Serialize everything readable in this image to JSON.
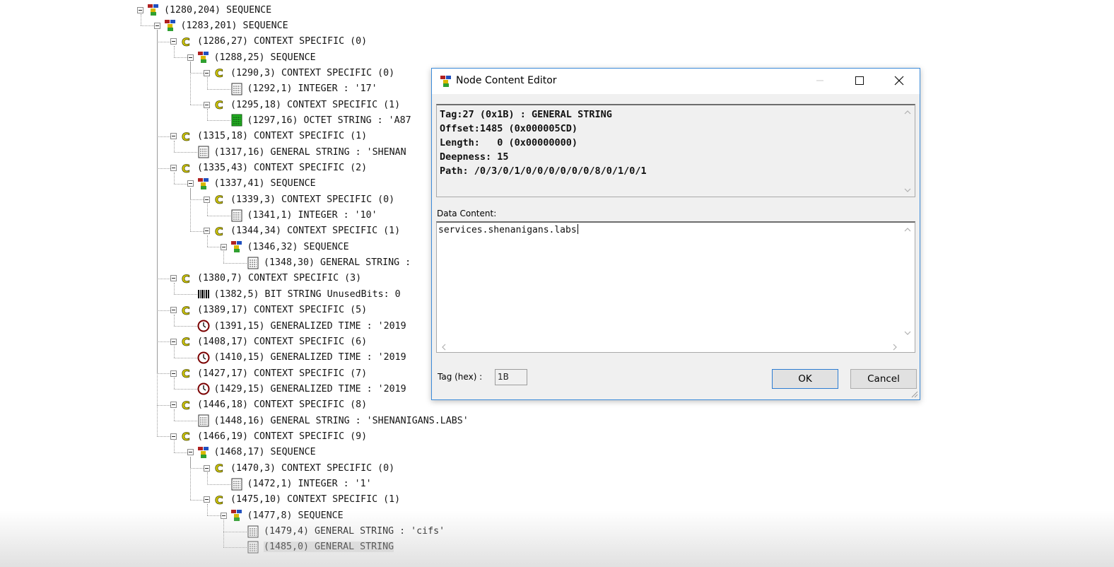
{
  "tree": {
    "nodes": [
      {
        "depth": 0,
        "icon": "sequence-icon",
        "text": "(1280,204) SEQUENCE",
        "expander": true
      },
      {
        "depth": 1,
        "icon": "sequence-icon",
        "text": "(1283,201) SEQUENCE",
        "expander": true
      },
      {
        "depth": 2,
        "icon": "context-specific-icon",
        "text": "(1286,27) CONTEXT SPECIFIC (0)",
        "expander": true
      },
      {
        "depth": 3,
        "icon": "sequence-icon",
        "text": "(1288,25) SEQUENCE",
        "expander": true
      },
      {
        "depth": 4,
        "icon": "context-specific-icon",
        "text": "(1290,3) CONTEXT SPECIFIC (0)",
        "expander": true
      },
      {
        "depth": 5,
        "icon": "integer-icon",
        "text": "(1292,1) INTEGER : '17'",
        "expander": false
      },
      {
        "depth": 4,
        "icon": "context-specific-icon",
        "text": "(1295,18) CONTEXT SPECIFIC (1)",
        "expander": true
      },
      {
        "depth": 5,
        "icon": "octet-string-icon",
        "text": "(1297,16) OCTET STRING : 'A87",
        "expander": false
      },
      {
        "depth": 2,
        "icon": "context-specific-icon",
        "text": "(1315,18) CONTEXT SPECIFIC (1)",
        "expander": true
      },
      {
        "depth": 3,
        "icon": "general-string-icon",
        "text": "(1317,16) GENERAL STRING : 'SHENAN",
        "expander": false
      },
      {
        "depth": 2,
        "icon": "context-specific-icon",
        "text": "(1335,43) CONTEXT SPECIFIC (2)",
        "expander": true
      },
      {
        "depth": 3,
        "icon": "sequence-icon",
        "text": "(1337,41) SEQUENCE",
        "expander": true
      },
      {
        "depth": 4,
        "icon": "context-specific-icon",
        "text": "(1339,3) CONTEXT SPECIFIC (0)",
        "expander": true
      },
      {
        "depth": 5,
        "icon": "integer-icon",
        "text": "(1341,1) INTEGER : '10'",
        "expander": false
      },
      {
        "depth": 4,
        "icon": "context-specific-icon",
        "text": "(1344,34) CONTEXT SPECIFIC (1)",
        "expander": true
      },
      {
        "depth": 5,
        "icon": "sequence-icon",
        "text": "(1346,32) SEQUENCE",
        "expander": true
      },
      {
        "depth": 6,
        "icon": "general-string-icon",
        "text": "(1348,30) GENERAL STRING :",
        "expander": false
      },
      {
        "depth": 2,
        "icon": "context-specific-icon",
        "text": "(1380,7) CONTEXT SPECIFIC (3)",
        "expander": true
      },
      {
        "depth": 3,
        "icon": "bit-string-icon",
        "text": "(1382,5) BIT STRING UnusedBits: 0",
        "expander": false
      },
      {
        "depth": 2,
        "icon": "context-specific-icon",
        "text": "(1389,17) CONTEXT SPECIFIC (5)",
        "expander": true
      },
      {
        "depth": 3,
        "icon": "clock-icon",
        "text": "(1391,15) GENERALIZED TIME : '2019",
        "expander": false
      },
      {
        "depth": 2,
        "icon": "context-specific-icon",
        "text": "(1408,17) CONTEXT SPECIFIC (6)",
        "expander": true
      },
      {
        "depth": 3,
        "icon": "clock-icon",
        "text": "(1410,15) GENERALIZED TIME : '2019",
        "expander": false
      },
      {
        "depth": 2,
        "icon": "context-specific-icon",
        "text": "(1427,17) CONTEXT SPECIFIC (7)",
        "expander": true
      },
      {
        "depth": 3,
        "icon": "clock-icon",
        "text": "(1429,15) GENERALIZED TIME : '2019",
        "expander": false
      },
      {
        "depth": 2,
        "icon": "context-specific-icon",
        "text": "(1446,18) CONTEXT SPECIFIC (8)",
        "expander": true
      },
      {
        "depth": 3,
        "icon": "general-string-icon",
        "text": "(1448,16) GENERAL STRING : 'SHENANIGANS.LABS'",
        "expander": false
      },
      {
        "depth": 2,
        "icon": "context-specific-icon",
        "text": "(1466,19) CONTEXT SPECIFIC (9)",
        "expander": true
      },
      {
        "depth": 3,
        "icon": "sequence-icon",
        "text": "(1468,17) SEQUENCE",
        "expander": true
      },
      {
        "depth": 4,
        "icon": "context-specific-icon",
        "text": "(1470,3) CONTEXT SPECIFIC (0)",
        "expander": true
      },
      {
        "depth": 5,
        "icon": "integer-icon",
        "text": "(1472,1) INTEGER : '1'",
        "expander": false
      },
      {
        "depth": 4,
        "icon": "context-specific-icon",
        "text": "(1475,10) CONTEXT SPECIFIC (1)",
        "expander": true
      },
      {
        "depth": 5,
        "icon": "sequence-icon",
        "text": "(1477,8) SEQUENCE",
        "expander": true
      },
      {
        "depth": 6,
        "icon": "general-string-icon",
        "text": "(1479,4) GENERAL STRING : 'cifs'",
        "expander": false
      },
      {
        "depth": 6,
        "icon": "general-string-icon",
        "text": "(1485,0) GENERAL STRING",
        "expander": false,
        "selected": true
      }
    ]
  },
  "dialog": {
    "title": "Node Content Editor",
    "title_icon": "sequence-icon",
    "header_lines": [
      "Tag:27 (0x1B) : GENERAL STRING",
      "Offset:1485 (0x000005CD)",
      "Length:   0 (0x00000000)",
      "Deepness: 15",
      "Path: /0/3/0/1/0/0/0/0/0/0/8/0/1/0/1"
    ],
    "data_content_label": "Data Content:",
    "data_content_value": "services.shenanigans.labs",
    "tag_label": "Tag (hex) :",
    "tag_value": "1B",
    "ok_label": "OK",
    "cancel_label": "Cancel"
  },
  "colors": {
    "dialog_border": "#3c8bd9",
    "context_icon_fill": "#d6cc00",
    "octet_icon_fill": "#22b022",
    "clock_icon_ring": "#7a0000"
  }
}
